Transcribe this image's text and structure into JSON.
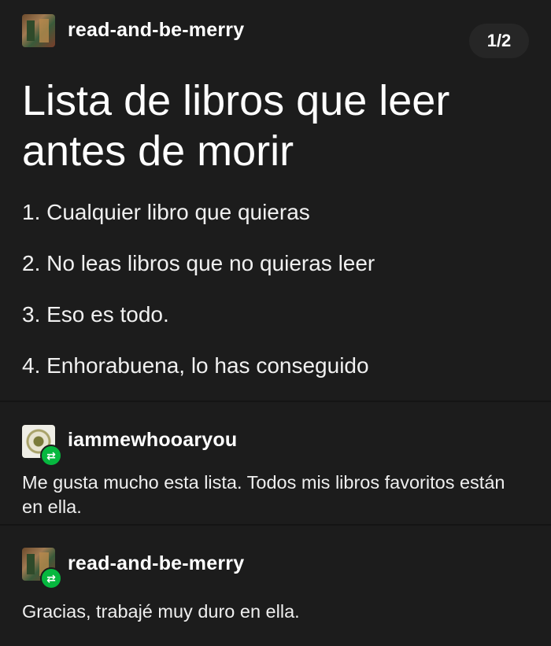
{
  "post": {
    "author": "read-and-be-merry",
    "counter": "1/2",
    "title": "Lista de libros que leer antes de morir",
    "items": [
      "1. Cualquier libro que quieras",
      "2. No leas libros que no quieras leer",
      "3. Eso es todo.",
      "4. Enhorabuena, lo has conseguido"
    ]
  },
  "reblogs": [
    {
      "author": "iammewhooaryou",
      "text": "Me gusta mucho esta lista. Todos mis libros favoritos están en ella."
    },
    {
      "author": "read-and-be-merry",
      "text": "Gracias, trabajé muy duro en ella."
    }
  ],
  "icons": {
    "reblog": "reblog-icon"
  },
  "colors": {
    "background": "#1c1c1c",
    "reblog_green": "#06b83f",
    "text": "#f2f2f2"
  }
}
